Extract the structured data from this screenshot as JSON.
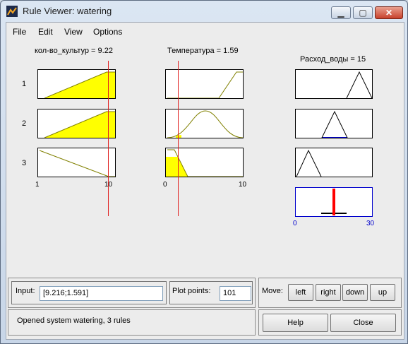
{
  "window": {
    "title": "Rule Viewer: watering"
  },
  "menu": [
    "File",
    "Edit",
    "View",
    "Options"
  ],
  "inputs": [
    {
      "label": "кол-во_культур = 9.22",
      "range_min": "1",
      "range_max": "10"
    },
    {
      "label": "Температура = 1.59",
      "range_min": "0",
      "range_max": "10"
    }
  ],
  "output": {
    "label": "Расход_воды = 15",
    "range_min": "0",
    "range_max": "30"
  },
  "rules": [
    "1",
    "2",
    "3"
  ],
  "colors": {
    "fill": "#ffff00",
    "mf_line": "#808000",
    "cursor": "#e02020",
    "output_bar": "#ff0000",
    "axis_blue": "#0000cc"
  },
  "bottom": {
    "input_label": "Input:",
    "input_value": "[9.216;1.591]",
    "plot_points_label": "Plot points:",
    "plot_points_value": "101",
    "move_label": "Move:",
    "move_buttons": [
      "left",
      "right",
      "down",
      "up"
    ],
    "status": "Opened system watering, 3 rules",
    "help": "Help",
    "close": "Close"
  }
}
